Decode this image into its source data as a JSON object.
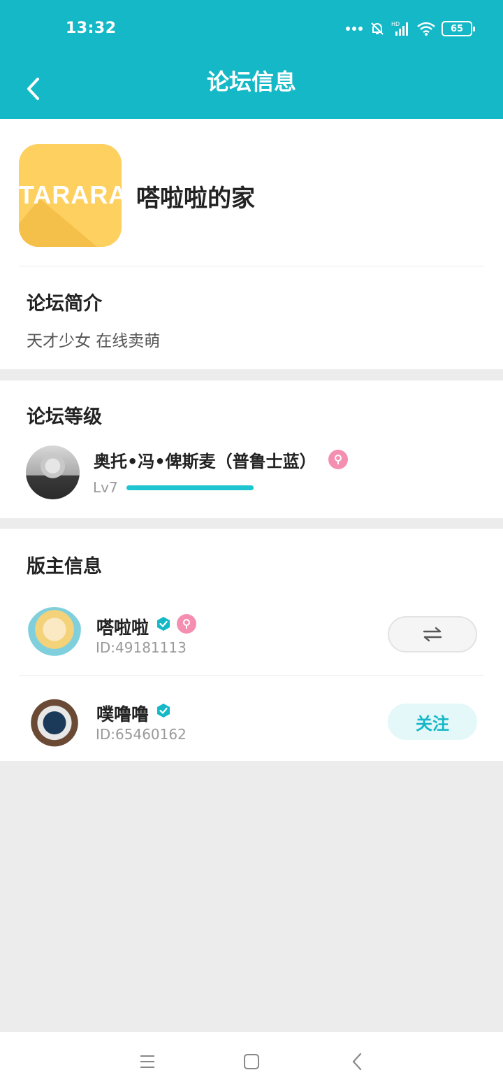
{
  "status_bar": {
    "time": "13:32",
    "battery": "65"
  },
  "app_bar": {
    "title": "论坛信息"
  },
  "forum": {
    "logo_text": "TARARA",
    "name": "嗒啦啦的家",
    "intro_title": "论坛简介",
    "intro_text": "天才少女 在线卖萌"
  },
  "level": {
    "title": "论坛等级",
    "user_name": "奥托•冯•俾斯麦（普鲁士蓝）",
    "level_label": "Lv7",
    "progress": 1.0
  },
  "moderators": {
    "title": "版主信息",
    "items": [
      {
        "name": "嗒啦啦",
        "id": "ID:49181113",
        "verified": true,
        "action": "switch"
      },
      {
        "name": "噗噜噜",
        "id": "ID:65460162",
        "verified": true,
        "action": "follow",
        "action_label": "关注"
      }
    ]
  },
  "colors": {
    "accent": "#15b8c6",
    "badge_pink": "#f48fb1",
    "logo_yellow": "#fdd060"
  },
  "icons": [
    "back-arrow-icon",
    "bell-muted-icon",
    "signal-icon",
    "wifi-icon",
    "battery-icon",
    "verified-icon",
    "gender-badge-icon",
    "swap-icon",
    "menu-icon",
    "home-icon",
    "back-icon"
  ]
}
